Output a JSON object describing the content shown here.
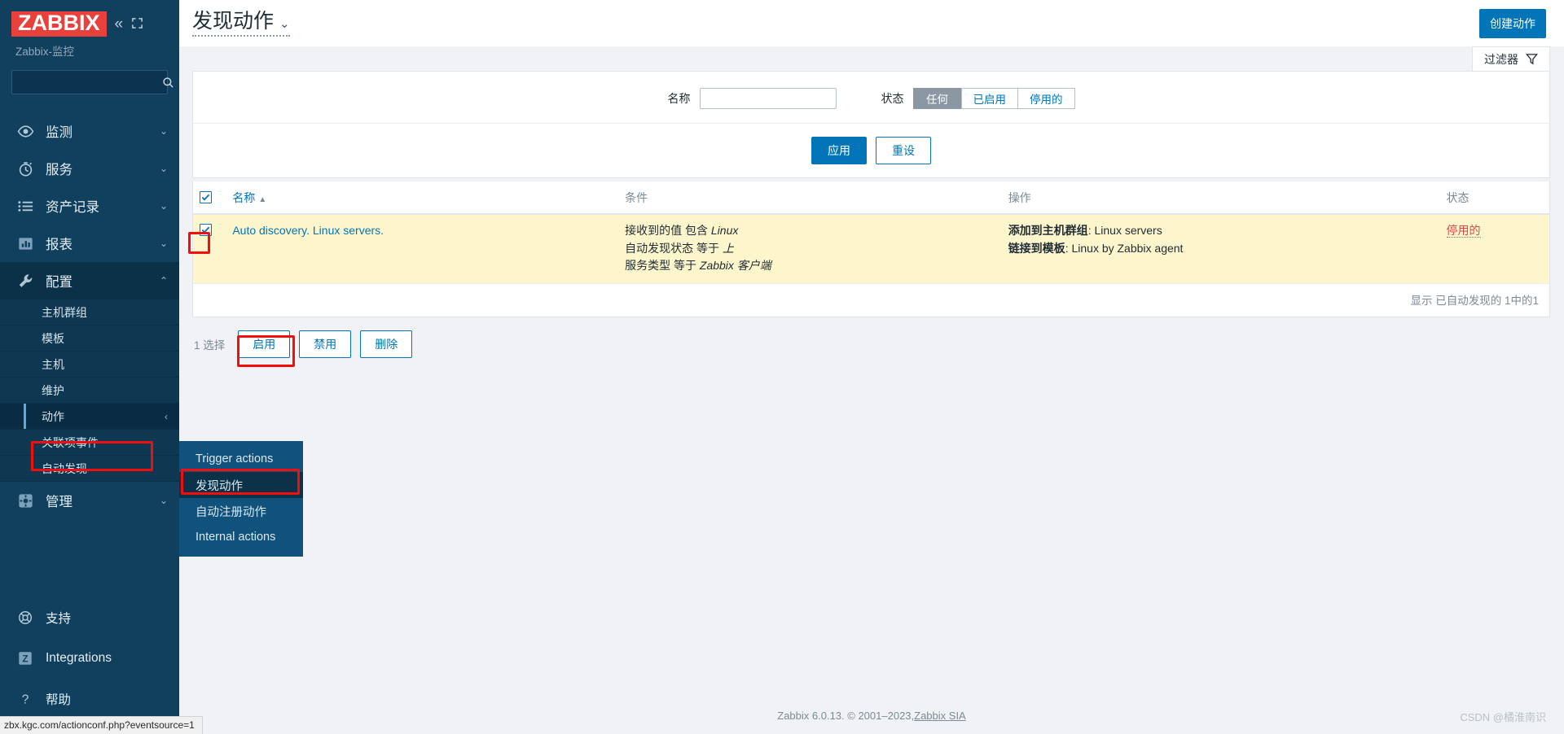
{
  "sidebar": {
    "logo": "ZABBIX",
    "server_name": "Zabbix-监控",
    "collapse_icon": "«",
    "expand_icon": "⛶",
    "search_placeholder": "",
    "search_value": "",
    "nav": [
      {
        "label": "监测",
        "icon": "eye-icon",
        "chevron": "⌄"
      },
      {
        "label": "服务",
        "icon": "clock-icon",
        "chevron": "⌄"
      },
      {
        "label": "资产记录",
        "icon": "list-icon",
        "chevron": "⌄"
      },
      {
        "label": "报表",
        "icon": "bar-chart-icon",
        "chevron": "⌄"
      },
      {
        "label": "配置",
        "icon": "wrench-icon",
        "chevron": "⌃"
      }
    ],
    "config_submenu": [
      {
        "label": "主机群组"
      },
      {
        "label": "模板"
      },
      {
        "label": "主机"
      },
      {
        "label": "维护"
      },
      {
        "label": "动作",
        "chevron": "‹"
      },
      {
        "label": "关联项事件"
      },
      {
        "label": "自动发现"
      }
    ],
    "admin": {
      "label": "管理",
      "icon": "cog-icon",
      "chevron": "⌄"
    },
    "bottom": [
      {
        "label": "支持",
        "icon": "lifebuoy-icon"
      },
      {
        "label": "Integrations",
        "icon": "z-square-icon"
      },
      {
        "label": "帮助",
        "icon": "question-icon"
      }
    ]
  },
  "flyout": {
    "items": [
      {
        "label": "Trigger actions",
        "selected": false
      },
      {
        "label": "发现动作",
        "selected": true
      },
      {
        "label": "自动注册动作",
        "selected": false
      },
      {
        "label": "Internal actions",
        "selected": false
      }
    ]
  },
  "header": {
    "title": "发现动作",
    "title_chevron": "⌄",
    "create_button": "创建动作"
  },
  "filter": {
    "tab_label": "过滤器",
    "tab_icon": "funnel-icon",
    "name_label": "名称",
    "name_value": "",
    "name_placeholder": "",
    "status_label": "状态",
    "status_options": [
      {
        "label": "任何",
        "selected": true
      },
      {
        "label": "已启用",
        "selected": false
      },
      {
        "label": "停用的",
        "selected": false
      }
    ],
    "apply_button": "应用",
    "reset_button": "重设"
  },
  "table": {
    "columns": [
      {
        "key": "checkbox",
        "label": ""
      },
      {
        "key": "name",
        "label": "名称",
        "sort": "▲"
      },
      {
        "key": "conditions",
        "label": "条件"
      },
      {
        "key": "operations",
        "label": "操作"
      },
      {
        "key": "status",
        "label": "状态"
      }
    ],
    "rows": [
      {
        "selected": true,
        "name": "Auto discovery. Linux servers.",
        "conditions": [
          {
            "text": "接收到的值 包含 ",
            "value": "Linux"
          },
          {
            "text": "自动发现状态 等于 ",
            "value": "上"
          },
          {
            "text": "服务类型 等于 ",
            "value": "Zabbix 客户端"
          }
        ],
        "operations": [
          {
            "label": "添加到主机群组",
            "value": "Linux servers"
          },
          {
            "label": "链接到模板",
            "value": "Linux by Zabbix agent"
          }
        ],
        "status": "停用的"
      }
    ],
    "footer_text": "显示 已自动发现的 1中的1"
  },
  "mass_actions": {
    "selected_text": "1 选择",
    "buttons": [
      {
        "label": "启用",
        "highlighted": true
      },
      {
        "label": "禁用",
        "highlighted": false
      },
      {
        "label": "删除",
        "highlighted": false
      }
    ]
  },
  "footer": {
    "text": "Zabbix 6.0.13. © 2001–2023, ",
    "link": "Zabbix SIA",
    "watermark": "CSDN @橘淮南识"
  },
  "statusbar": {
    "url": "zbx.kgc.com/actionconf.php?eventsource=1"
  },
  "colors": {
    "sidebar_bg": "#11405f",
    "accent": "#0275b8",
    "logo_red": "#e8403a",
    "row_highlight": "#fdf6cd",
    "status_disabled": "#d64949",
    "highlight_box": "#f40d0d"
  }
}
